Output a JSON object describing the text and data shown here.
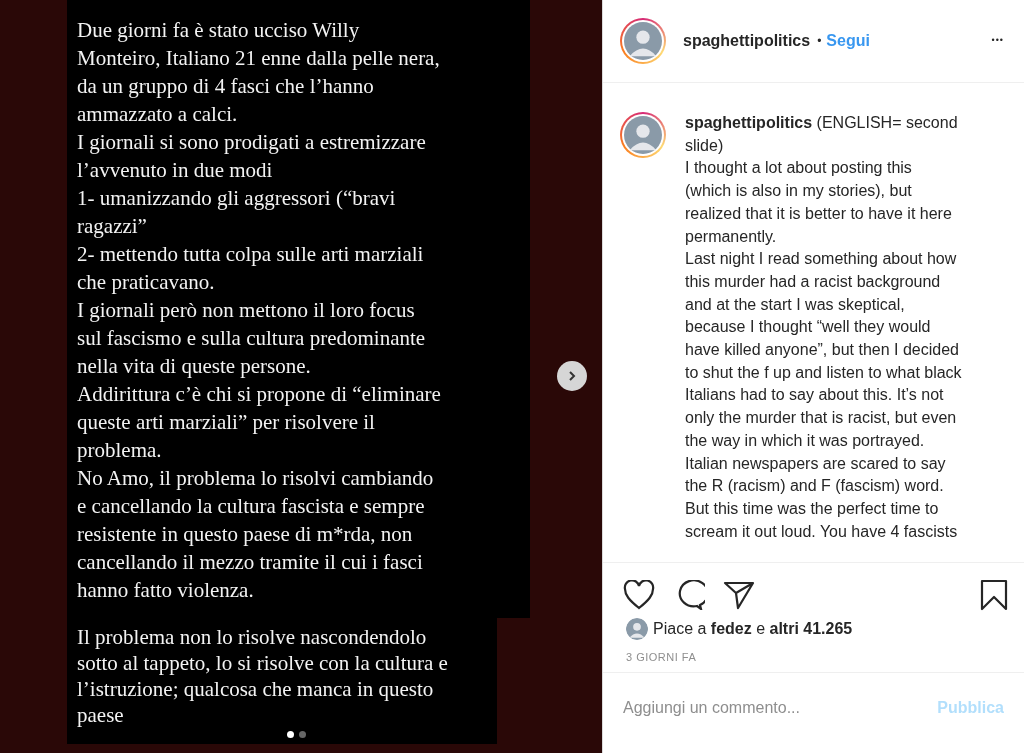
{
  "story": {
    "blocks": [
      {
        "paragraphs": [
          "Due giorni fa è stato ucciso Willy\nMonteiro, Italiano 21 enne dalla pelle nera,\nda un gruppo di 4 fasci che l’hanno\nammazzato a calci.",
          "I giornali si sono prodigati a estremizzare\nl’avvenuto in due modi",
          "1- umanizzando gli aggressori (“bravi\nragazzi”",
          "2- mettendo tutta colpa sulle arti marziali\nche praticavano.",
          "I giornali però non mettono il loro focus\nsul fascismo e sulla cultura predominante\nnella vita di queste persone.",
          "Addirittura c’è chi si propone di “eliminare\nqueste arti marziali” per risolvere il\nproblema.",
          "No Amo, il problema lo risolvi cambiando\ne cancellando la cultura fascista e sempre\nresistente in questo paese di m*rda, non\ncancellando il mezzo tramite il cui i fasci\nhanno fatto violenza."
        ]
      },
      {
        "paragraphs": [
          "Il problema non lo risolve nascondendolo\nsotto al tappeto, lo si risolve con la cultura e\nl’istruzione; qualcosa che manca in questo\npaese"
        ]
      }
    ],
    "slides": [
      {
        "selected": true
      },
      {
        "selected": false
      }
    ]
  },
  "header": {
    "username": "spaghettipolitics",
    "separator": "•",
    "follow": "Segui",
    "more": "•••"
  },
  "caption": {
    "username": "spaghettipolitics",
    "text": " (ENGLISH= second\nslide)\nI thought a lot about posting this\n(which is also in my stories), but\nrealized that it is better to have it here\npermanently.\nLast night I read something about how\nthis murder had a racist background\nand at the start I was skeptical,\nbecause I thought “well they would\nhave killed anyone”, but then I decided\nto shut the f up and listen to what black\nItalians had to say about this. It’s not\nonly the murder that is racist, but even\nthe way in which it was portrayed.\nItalian newspapers are scared to say\nthe R (racism) and F (fascism) word.\nBut this time was the perfect time to\nscream it out loud. You have 4 fascists"
  },
  "likes": {
    "text": "Piace a **fedez** e **altri 41.265**"
  },
  "time": "3 GIORNI FA",
  "comment": {
    "placeholder": "Aggiungi un commento...",
    "button": "Pubblica",
    "disabled": true
  }
}
